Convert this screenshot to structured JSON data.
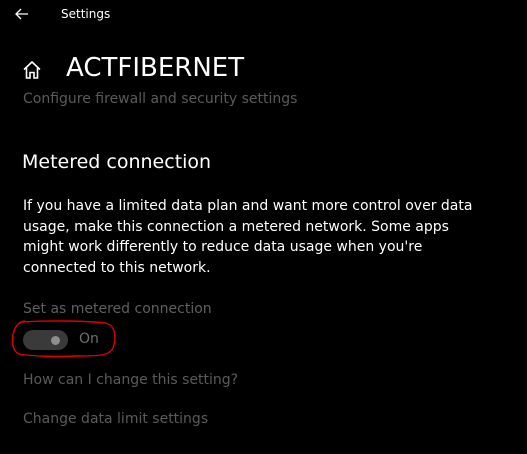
{
  "titlebar": {
    "title": "Settings",
    "back_icon": "back-arrow-icon"
  },
  "header": {
    "home_icon": "home-icon",
    "title": "ACTFIBERNET",
    "firewall_link": "Configure firewall and security settings"
  },
  "metered": {
    "section_title": "Metered connection",
    "description": "If you have a limited data plan and want more control over data usage, make this connection a metered network. Some apps might work differently to reduce data usage when you're connected to this network.",
    "toggle_label": "Set as metered connection",
    "toggle_state": "On",
    "toggle_on": true,
    "highlight_color": "#e00000"
  },
  "links": {
    "help": "How can I change this setting?",
    "data_limit": "Change data limit settings"
  }
}
